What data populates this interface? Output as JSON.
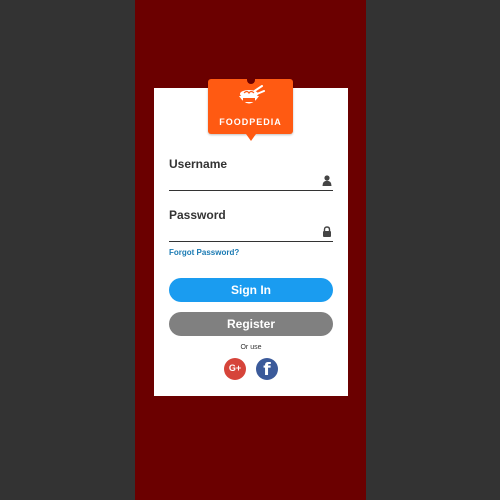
{
  "brand": {
    "name": "FOODPEDIA",
    "logo_icon": "noodle-bowl-chopsticks-icon",
    "color": "#ff5a12"
  },
  "colors": {
    "background": "#333333",
    "band": "#6b0000",
    "card": "#ffffff",
    "primary": "#1a9cf0",
    "secondary": "#808080",
    "link": "#1a7ab3"
  },
  "form": {
    "username": {
      "label": "Username",
      "value": "",
      "placeholder": "",
      "icon": "user-icon"
    },
    "password": {
      "label": "Password",
      "value": "",
      "placeholder": "",
      "icon": "lock-icon"
    },
    "forgot_label": "Forgot Password?",
    "signin_label": "Sign In",
    "register_label": "Register",
    "or_use_label": "Or use"
  },
  "social": {
    "google": {
      "label": "G+",
      "icon": "google-plus-icon",
      "color": "#d6443a"
    },
    "facebook": {
      "label": "f",
      "icon": "facebook-icon",
      "color": "#3b5a9a"
    }
  }
}
